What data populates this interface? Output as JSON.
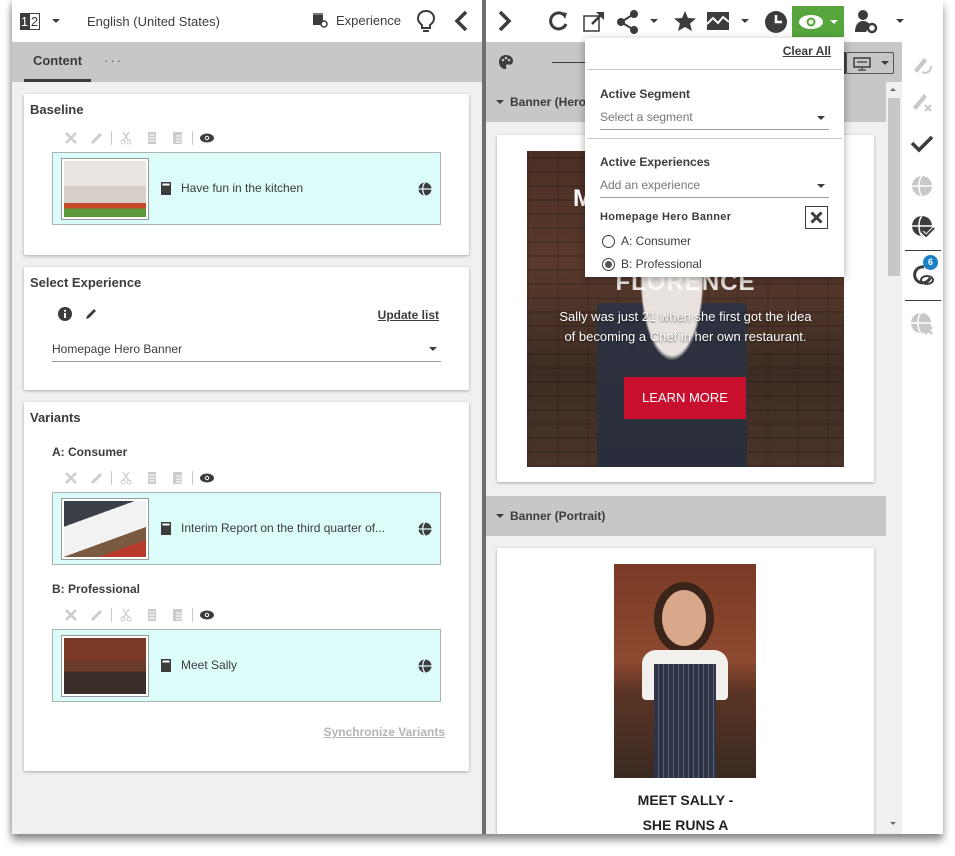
{
  "left_header": {
    "version_label_a": "1",
    "version_label_b": "2",
    "language": "English (United States)",
    "experience_button": "Experience"
  },
  "left_tabs": {
    "content": "Content",
    "more": "···"
  },
  "baseline": {
    "title": "Baseline",
    "item_title": "Have fun in the kitchen"
  },
  "select_experience": {
    "title": "Select Experience",
    "update_link": "Update list",
    "selected": "Homepage Hero Banner"
  },
  "variants": {
    "title": "Variants",
    "items": [
      {
        "label": "A: Consumer",
        "item_title": "Interim Report on the third quarter of..."
      },
      {
        "label": "B: Professional",
        "item_title": "Meet Sally"
      }
    ],
    "sync_link": "Synchronize Variants"
  },
  "preview_dropdown": {
    "clear_all": "Clear All",
    "active_segment": {
      "heading": "Active Segment",
      "placeholder": "Select a segment"
    },
    "active_experiences": {
      "heading": "Active Experiences",
      "placeholder": "Add an experience"
    },
    "experience": {
      "name": "Homepage Hero Banner",
      "options": [
        {
          "label": "A: Consumer",
          "checked": false
        },
        {
          "label": "B: Professional",
          "checked": true
        }
      ]
    }
  },
  "canvas": {
    "sections": [
      {
        "label": "Banner (Hero)"
      },
      {
        "label": "Banner (Portrait)"
      }
    ],
    "hero": {
      "title_start": "M",
      "title_line2": "FLORENCE",
      "description": "Sally was just 21 when she first got the idea of becoming a Chef in her own restaurant.",
      "button": "LEARN MORE"
    },
    "portrait": {
      "title_line1": "MEET SALLY -",
      "title_line2": "SHE RUNS A"
    }
  },
  "side_rail": {
    "badge_count": "6"
  },
  "colors": {
    "preview_active": "#56a53d",
    "cta": "#c8102e",
    "item_bg": "#dbfcf8",
    "badge": "#1a7fc7"
  }
}
